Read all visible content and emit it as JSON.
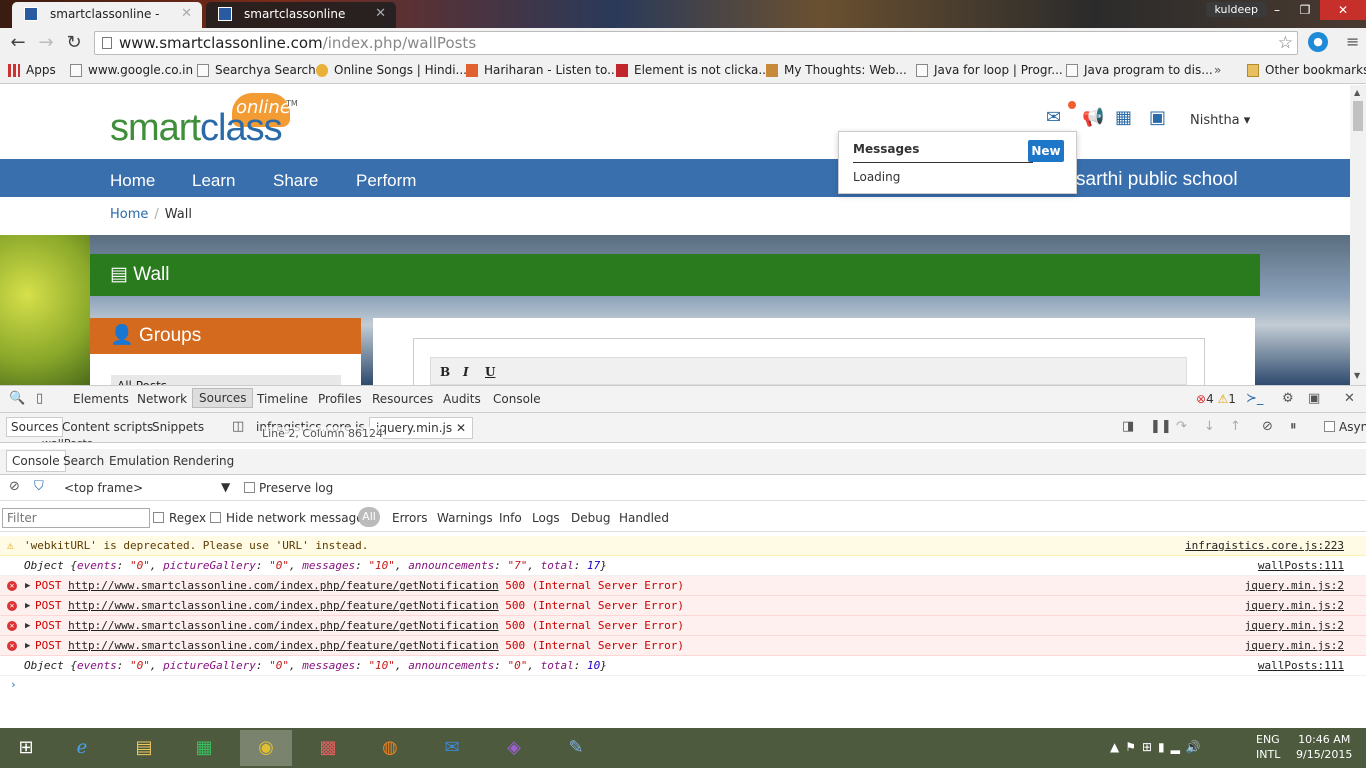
{
  "browser": {
    "tabs": [
      {
        "title": "smartclassonline - WallPo",
        "active": true
      },
      {
        "title": "smartclassonline",
        "active": false
      }
    ],
    "window_user": "kuldeep",
    "url_domain": "www.smartclassonline.com",
    "url_path": "/index.php/wallPosts",
    "bookmarks": [
      {
        "label": "Apps",
        "icon": "apps-icon"
      },
      {
        "label": "www.google.co.in",
        "icon": "page-icon"
      },
      {
        "label": "Searchya Search",
        "icon": "page-icon"
      },
      {
        "label": "Online Songs | Hindi...",
        "icon": "song-icon"
      },
      {
        "label": "Hariharan - Listen to...",
        "icon": "music-icon"
      },
      {
        "label": "Element is not clicka...",
        "icon": "s-icon"
      },
      {
        "label": "My Thoughts: Web...",
        "icon": "blog-icon"
      },
      {
        "label": "Java for loop | Progr...",
        "icon": "page-icon"
      },
      {
        "label": "Java program to dis...",
        "icon": "page-icon"
      },
      {
        "label": "Other bookmarks",
        "icon": "folder-icon"
      }
    ],
    "bookmarks_overflow": "»"
  },
  "site": {
    "logo": {
      "word1": "smart",
      "word2": "class",
      "tag": "online",
      "tm": "TM"
    },
    "user": "Nishtha",
    "nav": [
      "Home",
      "Learn",
      "Share",
      "Perform"
    ],
    "school": "sarthi public school",
    "breadcrumb": {
      "home": "Home",
      "sep": "/",
      "current": "Wall"
    },
    "wall_title": "Wall",
    "groups_title": "Groups",
    "groups_first": "All Posts",
    "editor_buttons": [
      "B",
      "I",
      "U"
    ],
    "messages": {
      "title": "Messages",
      "new_label": "New",
      "status": "Loading"
    }
  },
  "devtools": {
    "tabs": [
      "Elements",
      "Network",
      "Sources",
      "Timeline",
      "Profiles",
      "Resources",
      "Audits",
      "Console"
    ],
    "selected_tab": "Sources",
    "errors": "4",
    "warnings": "1",
    "source_tabs": [
      "Sources",
      "Content scripts",
      "Snippets"
    ],
    "file_tabs": [
      "infragistics.core.js",
      "jquery.min.js"
    ],
    "tree_item": "wallPosts",
    "line_col": "Line 2, Column 86124",
    "async_label": "Asyn",
    "drawer_tabs": [
      "Console",
      "Search",
      "Emulation",
      "Rendering"
    ],
    "context": "<top frame>",
    "preserve_log": "Preserve log",
    "filter_placeholder": "Filter",
    "regex": "Regex",
    "hide_network": "Hide network messages",
    "levels": [
      "All",
      "Errors",
      "Warnings",
      "Info",
      "Logs",
      "Debug",
      "Handled"
    ],
    "console_rows": [
      {
        "type": "warn",
        "text": "'webkitURL' is deprecated. Please use 'URL' instead.",
        "source": "infragistics.core.js:223"
      },
      {
        "type": "obj",
        "events": "\"0\"",
        "pictureGallery": "\"0\"",
        "messages": "\"10\"",
        "announcements": "\"7\"",
        "total": "17",
        "source": "wallPosts:111"
      },
      {
        "type": "err",
        "method": "POST",
        "url": "http://www.smartclassonline.com/index.php/feature/getNotification",
        "status": "500 (Internal Server Error)",
        "source": "jquery.min.js:2"
      },
      {
        "type": "err",
        "method": "POST",
        "url": "http://www.smartclassonline.com/index.php/feature/getNotification",
        "status": "500 (Internal Server Error)",
        "source": "jquery.min.js:2"
      },
      {
        "type": "err",
        "method": "POST",
        "url": "http://www.smartclassonline.com/index.php/feature/getNotification",
        "status": "500 (Internal Server Error)",
        "source": "jquery.min.js:2"
      },
      {
        "type": "err",
        "method": "POST",
        "url": "http://www.smartclassonline.com/index.php/feature/getNotification",
        "status": "500 (Internal Server Error)",
        "source": "jquery.min.js:2"
      },
      {
        "type": "obj",
        "events": "\"0\"",
        "pictureGallery": "\"0\"",
        "messages": "\"10\"",
        "announcements": "\"0\"",
        "total": "10",
        "source": "wallPosts:111"
      }
    ]
  },
  "taskbar": {
    "lang1": "ENG",
    "lang2": "INTL",
    "time": "10:46 AM",
    "date": "9/15/2015"
  }
}
